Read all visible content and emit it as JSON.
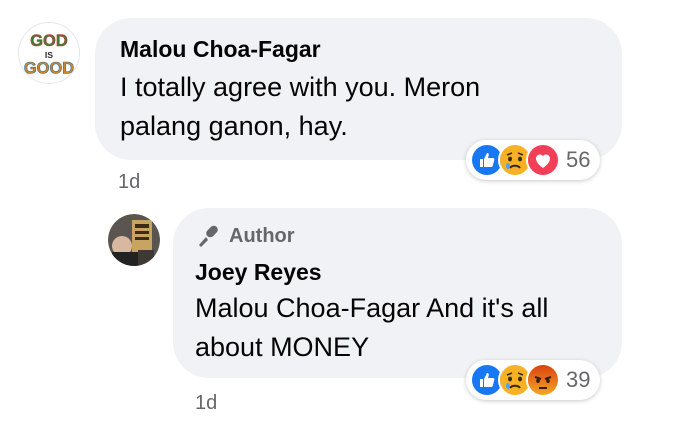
{
  "comments": [
    {
      "author": "Malou Choa-Fagar",
      "avatar_text": [
        "GOD",
        "IS",
        "GOOD"
      ],
      "line1": "I totally agree with you. Meron",
      "line2": "palang ganon, hay.",
      "reactions": [
        "like-icon",
        "sad-icon",
        "love-icon"
      ],
      "reaction_count": "56",
      "time": "1d"
    },
    {
      "badge": "Author",
      "author": "Joey Reyes",
      "line1": "Malou Choa-Fagar And it's all",
      "line2": "about MONEY",
      "reactions": [
        "like-icon",
        "sad-icon",
        "angry-icon"
      ],
      "reaction_count": "39",
      "time": "1d"
    }
  ],
  "colors": {
    "bubble": "#f0f2f5",
    "secondary_text": "#65676b",
    "like": "#1877f2",
    "love": "#f33e58",
    "sad": "#f7b125",
    "angry": "#e9710f"
  }
}
